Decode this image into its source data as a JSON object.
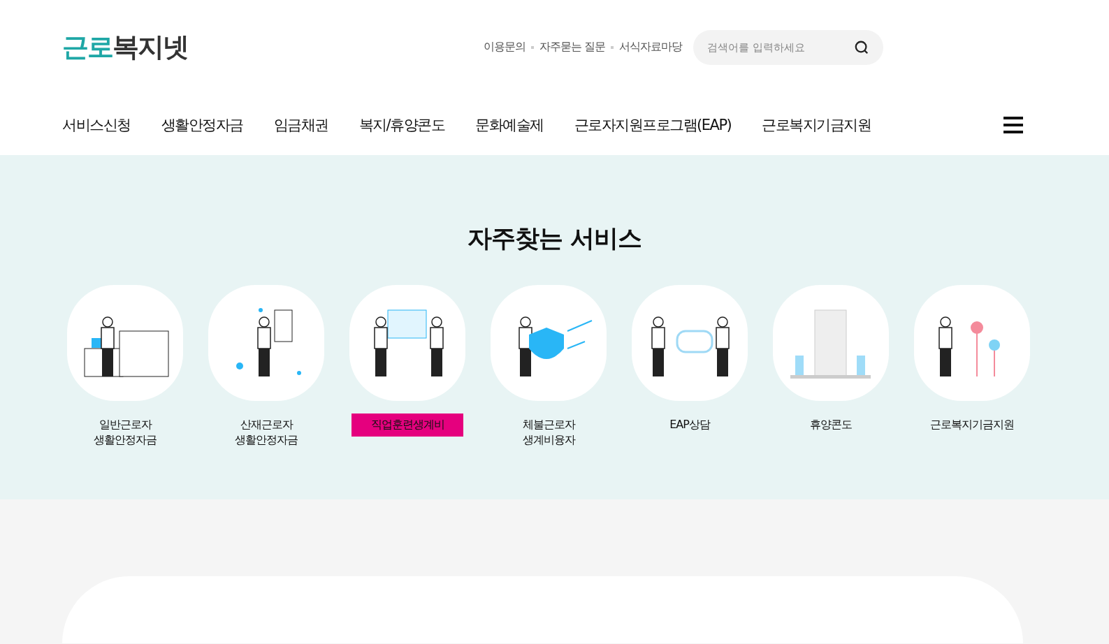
{
  "header": {
    "logo": "**근로**복지넷",
    "util_links": [
      "이용문의",
      "자주묻는 질문",
      "서식자료마당"
    ],
    "search": {
      "placeholder": "검색어를 입력하세요"
    }
  },
  "nav": [
    "서비스신청",
    "생활안정자금",
    "임금채권",
    "복지/휴양콘도",
    "문화예술제",
    "근로자지원프로그램(EAP)",
    "근로복지기금지원"
  ],
  "services": {
    "title": "자주찾는 서비스",
    "items": [
      {
        "label": "일반근로자\n생활안정자금",
        "selected": false
      },
      {
        "label": "산재근로자\n생활안정자금",
        "selected": false
      },
      {
        "label": "직업훈련생계비",
        "selected": true
      },
      {
        "label": "체불근로자\n생계비융자",
        "selected": false
      },
      {
        "label": "EAP상담",
        "selected": false
      },
      {
        "label": "휴양콘도",
        "selected": false
      },
      {
        "label": "근로복지기금지원",
        "selected": false
      }
    ]
  }
}
